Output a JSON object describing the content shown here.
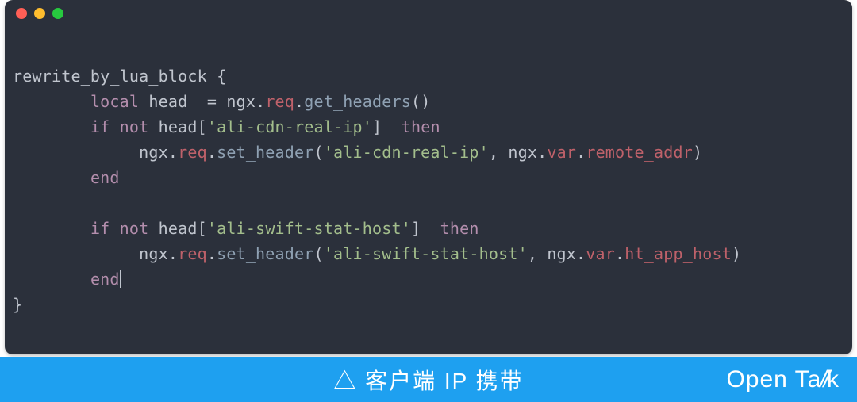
{
  "window": {
    "traffic_lights": {
      "close": "#ff5f56",
      "minimize": "#ffbd2e",
      "zoom": "#27c93f"
    }
  },
  "code": {
    "lines": [
      [
        {
          "t": "rewrite_by_lua_block ",
          "c": "plain"
        },
        {
          "t": "{",
          "c": "punc"
        }
      ],
      [
        {
          "t": "        ",
          "c": "plain"
        },
        {
          "t": "local",
          "c": "kw"
        },
        {
          "t": " head  ",
          "c": "plain"
        },
        {
          "t": "=",
          "c": "punc"
        },
        {
          "t": " ngx",
          "c": "plain"
        },
        {
          "t": ".",
          "c": "punc"
        },
        {
          "t": "req",
          "c": "id"
        },
        {
          "t": ".",
          "c": "punc"
        },
        {
          "t": "get_headers",
          "c": "fn"
        },
        {
          "t": "()",
          "c": "punc"
        }
      ],
      [
        {
          "t": "        ",
          "c": "plain"
        },
        {
          "t": "if",
          "c": "kw"
        },
        {
          "t": " ",
          "c": "plain"
        },
        {
          "t": "not",
          "c": "kw"
        },
        {
          "t": " head",
          "c": "plain"
        },
        {
          "t": "[",
          "c": "punc"
        },
        {
          "t": "'ali-cdn-real-ip'",
          "c": "str"
        },
        {
          "t": "]",
          "c": "punc"
        },
        {
          "t": "  ",
          "c": "plain"
        },
        {
          "t": "then",
          "c": "kw"
        }
      ],
      [
        {
          "t": "             ngx",
          "c": "plain"
        },
        {
          "t": ".",
          "c": "punc"
        },
        {
          "t": "req",
          "c": "id"
        },
        {
          "t": ".",
          "c": "punc"
        },
        {
          "t": "set_header",
          "c": "fn"
        },
        {
          "t": "(",
          "c": "punc"
        },
        {
          "t": "'ali-cdn-real-ip'",
          "c": "str"
        },
        {
          "t": ", ",
          "c": "punc"
        },
        {
          "t": "ngx",
          "c": "plain"
        },
        {
          "t": ".",
          "c": "punc"
        },
        {
          "t": "var",
          "c": "id"
        },
        {
          "t": ".",
          "c": "punc"
        },
        {
          "t": "remote_addr",
          "c": "id"
        },
        {
          "t": ")",
          "c": "punc"
        }
      ],
      [
        {
          "t": "        ",
          "c": "plain"
        },
        {
          "t": "end",
          "c": "kw"
        }
      ],
      [
        {
          "t": " ",
          "c": "plain"
        }
      ],
      [
        {
          "t": "        ",
          "c": "plain"
        },
        {
          "t": "if",
          "c": "kw"
        },
        {
          "t": " ",
          "c": "plain"
        },
        {
          "t": "not",
          "c": "kw"
        },
        {
          "t": " head",
          "c": "plain"
        },
        {
          "t": "[",
          "c": "punc"
        },
        {
          "t": "'ali-swift-stat-host'",
          "c": "str"
        },
        {
          "t": "]",
          "c": "punc"
        },
        {
          "t": "  ",
          "c": "plain"
        },
        {
          "t": "then",
          "c": "kw"
        }
      ],
      [
        {
          "t": "             ngx",
          "c": "plain"
        },
        {
          "t": ".",
          "c": "punc"
        },
        {
          "t": "req",
          "c": "id"
        },
        {
          "t": ".",
          "c": "punc"
        },
        {
          "t": "set_header",
          "c": "fn"
        },
        {
          "t": "(",
          "c": "punc"
        },
        {
          "t": "'ali-swift-stat-host'",
          "c": "str"
        },
        {
          "t": ", ",
          "c": "punc"
        },
        {
          "t": "ngx",
          "c": "plain"
        },
        {
          "t": ".",
          "c": "punc"
        },
        {
          "t": "var",
          "c": "id"
        },
        {
          "t": ".",
          "c": "punc"
        },
        {
          "t": "ht_app_host",
          "c": "id"
        },
        {
          "t": ")",
          "c": "punc"
        }
      ],
      [
        {
          "t": "        ",
          "c": "plain"
        },
        {
          "t": "end",
          "c": "kw",
          "cursor": true
        }
      ],
      [
        {
          "t": "}",
          "c": "punc"
        }
      ]
    ]
  },
  "footer": {
    "caption_prefix": "△ ",
    "caption": "客户端 IP 携带",
    "brand_main": "Open Ta",
    "brand_slashes": "//",
    "brand_tail": "k"
  }
}
